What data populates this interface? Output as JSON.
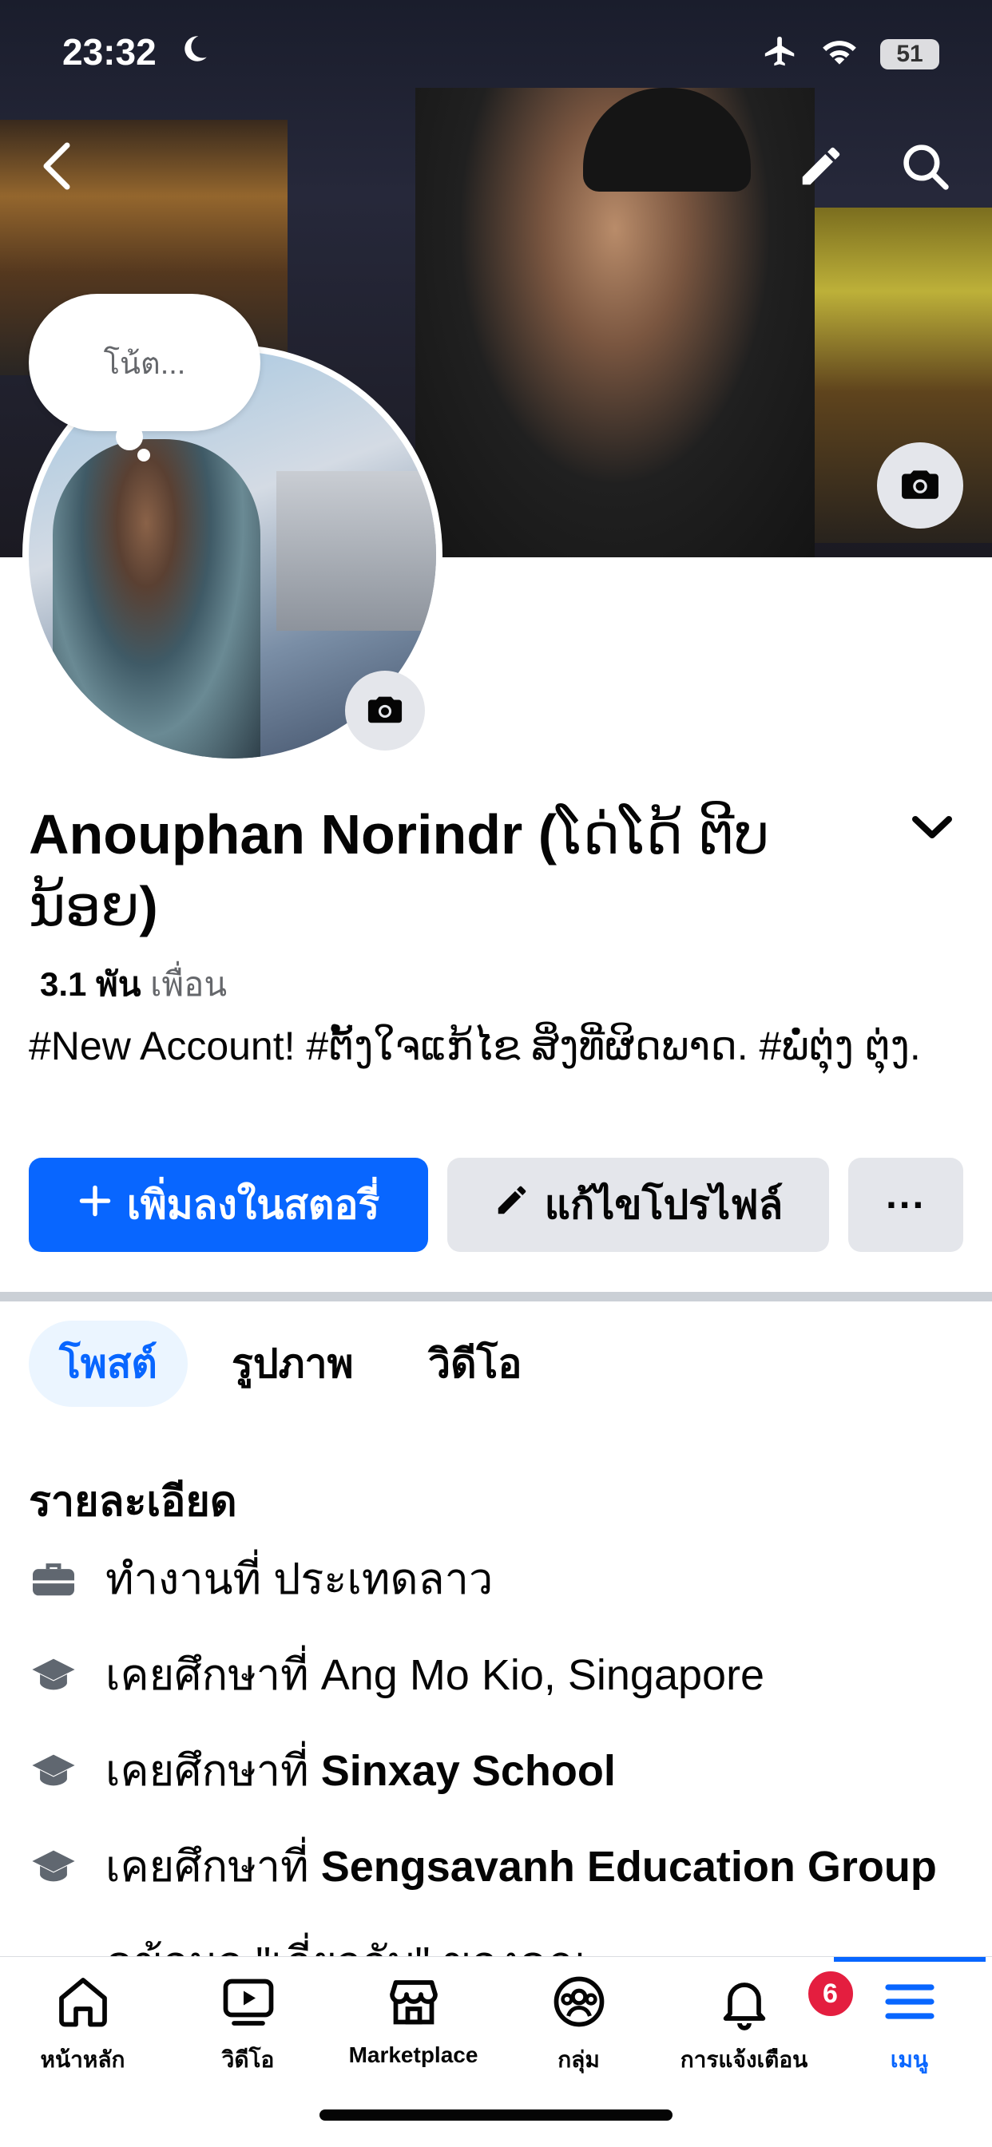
{
  "status_bar": {
    "time": "23:32",
    "battery": "51"
  },
  "note": {
    "placeholder": "โน้ต..."
  },
  "profile": {
    "name_latin": "Anouphan Norindr (",
    "name_lao": "ໂດ່ໂດ້ ຕີບ ນ້ອຍ",
    "name_close": ")",
    "friend_count": "3.1 พัน",
    "friend_label": "เพื่อน",
    "bio": "#New Account! #ຕັ້ງໃຈແກ້ໄຂ ສິ່ງທີ່ຜິດພາດ. #ພໍ່ຕຸ່ງ ຕຸ່ງ."
  },
  "actions": {
    "add_story": "เพิ่มลงในสตอรี่",
    "edit_profile": "แก้ไขโปรไฟล์",
    "more": "···"
  },
  "tabs": [
    {
      "label": "โพสต์",
      "active": true
    },
    {
      "label": "รูปภาพ",
      "active": false
    },
    {
      "label": "วิดีโอ",
      "active": false
    }
  ],
  "details": {
    "heading": "รายละเอียด",
    "work": {
      "prefix": "ทำงานที่",
      "place": "ประเทดลาว"
    },
    "education": [
      {
        "prefix": "เคยศึกษาที่",
        "place": "Ang Mo Kio, Singapore",
        "bold": false
      },
      {
        "prefix": "เคยศึกษาที่",
        "place": "Sinxay School",
        "bold": true
      },
      {
        "prefix": "เคยศึกษาที่",
        "place": "Sengsavanh Education Group",
        "bold": true
      }
    ],
    "about_partial": "ดูข้อมูล \"เกี่ยวกับ\" ของคุณ"
  },
  "bottom_nav": [
    {
      "label": "หน้าหลัก",
      "icon": "home-icon"
    },
    {
      "label": "วิดีโอ",
      "icon": "video-icon"
    },
    {
      "label": "Marketplace",
      "icon": "marketplace-icon"
    },
    {
      "label": "กลุ่ม",
      "icon": "groups-icon"
    },
    {
      "label": "การแจ้งเตือน",
      "icon": "bell-icon",
      "badge": "6"
    },
    {
      "label": "เมนู",
      "icon": "menu-icon",
      "active": true
    }
  ],
  "colors": {
    "accent": "#0866ff",
    "badge": "#e41e3f",
    "secondary_button": "#e4e6eb"
  }
}
